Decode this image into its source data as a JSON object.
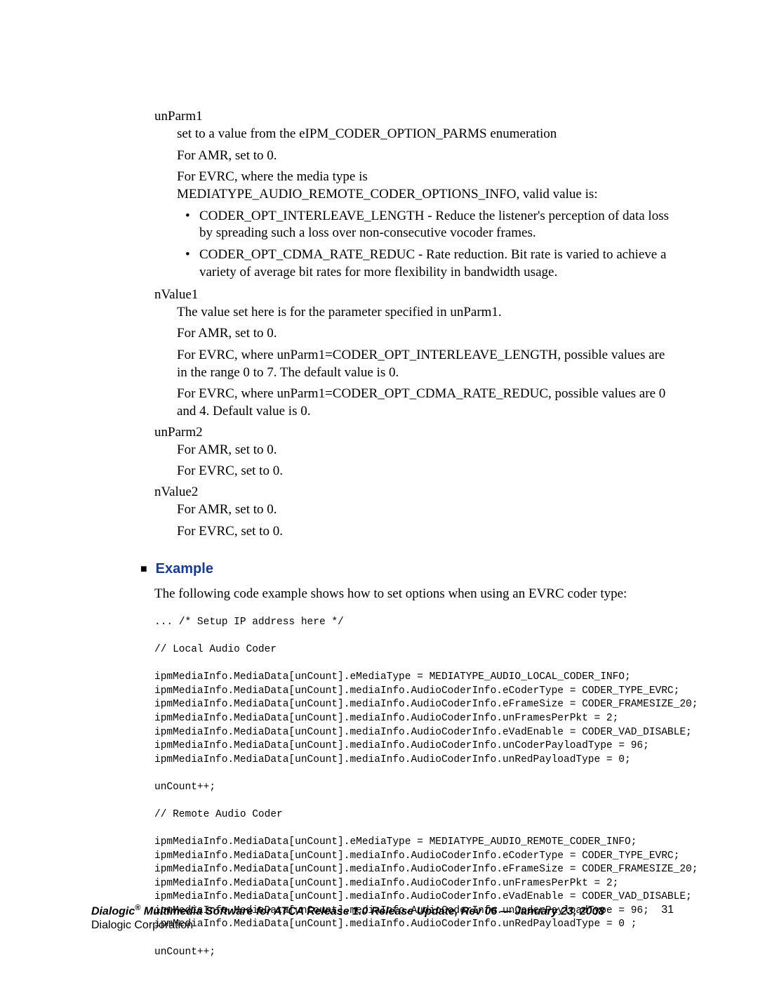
{
  "params": {
    "unParm1": {
      "term": "unParm1",
      "p1": "set to a value from the eIPM_CODER_OPTION_PARMS enumeration",
      "p2": "For AMR, set to 0.",
      "p3": "For EVRC, where the media type is MEDIATYPE_AUDIO_REMOTE_CODER_OPTIONS_INFO, valid value is:",
      "b1": "CODER_OPT_INTERLEAVE_LENGTH - Reduce the listener's perception of data loss by spreading such a loss over non-consecutive vocoder frames.",
      "b2": "CODER_OPT_CDMA_RATE_REDUC - Rate reduction. Bit rate is varied to achieve a variety of average bit rates for more flexibility in bandwidth usage."
    },
    "nValue1": {
      "term": "nValue1",
      "p1": "The value set here is for the parameter specified in unParm1.",
      "p2": "For AMR, set to 0.",
      "p3": "For EVRC, where unParm1=CODER_OPT_INTERLEAVE_LENGTH, possible values are in the range 0 to 7. The default value is 0.",
      "p4": "For EVRC, where unParm1=CODER_OPT_CDMA_RATE_REDUC, possible values are 0 and 4. Default value is 0."
    },
    "unParm2": {
      "term": "unParm2",
      "p1": "For AMR, set to 0.",
      "p2": "For EVRC, set to 0."
    },
    "nValue2": {
      "term": "nValue2",
      "p1": "For AMR, set to 0.",
      "p2": "For EVRC, set to 0."
    }
  },
  "example": {
    "heading": "Example",
    "intro": "The following code example shows how to set options when using an EVRC coder type:",
    "code": "... /* Setup IP address here */\n\n// Local Audio Coder\n\nipmMediaInfo.MediaData[unCount].eMediaType = MEDIATYPE_AUDIO_LOCAL_CODER_INFO;\nipmMediaInfo.MediaData[unCount].mediaInfo.AudioCoderInfo.eCoderType = CODER_TYPE_EVRC;\nipmMediaInfo.MediaData[unCount].mediaInfo.AudioCoderInfo.eFrameSize = CODER_FRAMESIZE_20;\nipmMediaInfo.MediaData[unCount].mediaInfo.AudioCoderInfo.unFramesPerPkt = 2;\nipmMediaInfo.MediaData[unCount].mediaInfo.AudioCoderInfo.eVadEnable = CODER_VAD_DISABLE;\nipmMediaInfo.MediaData[unCount].mediaInfo.AudioCoderInfo.unCoderPayloadType = 96;\nipmMediaInfo.MediaData[unCount].mediaInfo.AudioCoderInfo.unRedPayloadType = 0;\n\nunCount++;\n\n// Remote Audio Coder\n\nipmMediaInfo.MediaData[unCount].eMediaType = MEDIATYPE_AUDIO_REMOTE_CODER_INFO;\nipmMediaInfo.MediaData[unCount].mediaInfo.AudioCoderInfo.eCoderType = CODER_TYPE_EVRC;\nipmMediaInfo.MediaData[unCount].mediaInfo.AudioCoderInfo.eFrameSize = CODER_FRAMESIZE_20;\nipmMediaInfo.MediaData[unCount].mediaInfo.AudioCoderInfo.unFramesPerPkt = 2;\nipmMediaInfo.MediaData[unCount].mediaInfo.AudioCoderInfo.eVadEnable = CODER_VAD_DISABLE;\nipmMediaInfo.MediaData[unCount].mediaInfo.AudioCoderInfo.unCoderPayloadType = 96;\nipmMediaInfo.MediaData[unCount].mediaInfo.AudioCoderInfo.unRedPayloadType = 0 ;\n\nunCount++;"
  },
  "footer": {
    "title_pre": "Dialogic",
    "reg": "®",
    "title_post": " Multimedia Software for ATCA Release 1.0 Release Update, Rev 06 — January 23, 2008",
    "page": "31",
    "org": "Dialogic Corporation"
  }
}
